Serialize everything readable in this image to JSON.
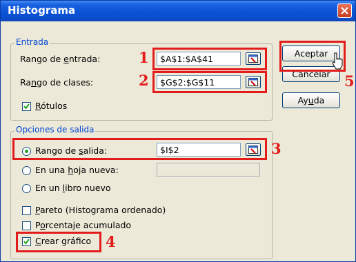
{
  "window": {
    "title": "Histograma"
  },
  "entrada": {
    "legend": "Entrada",
    "rango_entrada": {
      "label_pre": "Rango de ",
      "label_u": "e",
      "label_post": "ntrada:",
      "value": "$A$1:$A$41"
    },
    "rango_clases": {
      "label_pre": "Ra",
      "label_u": "n",
      "label_post": "go de clases:",
      "value": "$G$2:$G$11"
    },
    "rotulos": {
      "label_u": "R",
      "label_post": "ótulos",
      "checked": true
    }
  },
  "salida": {
    "legend": "Opciones de salida",
    "rango_salida": {
      "label_pre": "Rango de ",
      "label_u": "s",
      "label_post": "alida:",
      "value": "$I$2",
      "selected": true
    },
    "hoja_nueva": {
      "label_pre": "En una ",
      "label_u": "h",
      "label_post": "oja nueva:",
      "value": ""
    },
    "libro_nuevo": {
      "label_pre": "En un ",
      "label_u": "l",
      "label_post": "ibro nuevo"
    },
    "pareto": {
      "label_u": "P",
      "label_post": "areto (Histograma ordenado)",
      "checked": false
    },
    "porcentaje": {
      "label_pre": "P",
      "label_u": "o",
      "label_post": "rcentaje acumulado",
      "checked": false
    },
    "crear_grafico": {
      "label_u": "C",
      "label_post": "rear gráfico",
      "checked": true
    }
  },
  "buttons": {
    "aceptar": "Aceptar",
    "cancelar": "Cancelar",
    "ayuda_pre": "Ay",
    "ayuda_u": "u",
    "ayuda_post": "da"
  },
  "annotations": [
    "1",
    "2",
    "3",
    "4",
    "5"
  ],
  "colors": {
    "highlight": "#e21b1b",
    "title_bar": "#0b55d8",
    "legend_text": "#0046d5"
  }
}
